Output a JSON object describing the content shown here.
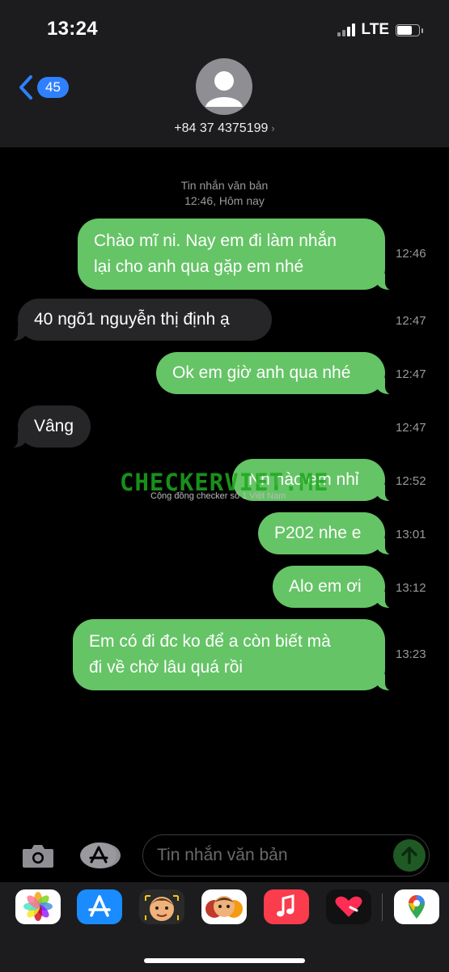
{
  "status": {
    "time": "13:24",
    "network": "LTE"
  },
  "header": {
    "back_count": "45",
    "contact": "+84 37 4375199"
  },
  "conversation": {
    "meta_line1": "Tin nhắn văn bản",
    "meta_line2": "12:46, Hôm nay",
    "messages": [
      {
        "dir": "sent",
        "lines": [
          "Chào mĩ ni. Nay em đi làm nhắn",
          "lại cho anh qua gặp em nhé"
        ],
        "time": "12:46"
      },
      {
        "dir": "received",
        "lines": [
          "40 ngõ1 nguyễn thị định ạ"
        ],
        "time": "12:47"
      },
      {
        "dir": "sent",
        "lines": [
          "Ok em giờ anh qua nhé"
        ],
        "time": "12:47"
      },
      {
        "dir": "received",
        "lines": [
          "Vâng"
        ],
        "time": "12:47"
      },
      {
        "dir": "sent",
        "lines": [
          "Nn nào em nhỉ"
        ],
        "time": "12:52"
      },
      {
        "dir": "sent",
        "lines": [
          "P202 nhe e"
        ],
        "time": "13:01"
      },
      {
        "dir": "sent",
        "lines": [
          "Alo em ơi"
        ],
        "time": "13:12"
      },
      {
        "dir": "sent",
        "lines": [
          "Em có đi đc ko để a còn biết mà",
          "đi về chờ lâu quá rồi"
        ],
        "time": "13:23"
      }
    ]
  },
  "watermark": {
    "title": "CHECKERVIET.ME",
    "subtitle": "Cộng đồng checker số 1 Việt Nam"
  },
  "composer": {
    "placeholder": "Tin nhắn văn bản"
  },
  "apps": [
    {
      "name": "photos-app-icon",
      "color": "#ffffff"
    },
    {
      "name": "appstore-app-icon",
      "color": "#1a8cff"
    },
    {
      "name": "memoji-app-icon",
      "color": "#2a2a2a"
    },
    {
      "name": "animoji-app-icon",
      "color": "#ffffff"
    },
    {
      "name": "music-app-icon",
      "color": "#fa3c4c"
    },
    {
      "name": "digital-touch-app-icon",
      "color": "#111111"
    },
    {
      "name": "maps-app-icon",
      "color": "#ffffff"
    }
  ],
  "colors": {
    "sent_bubble": "#65c466",
    "received_bubble": "#262628",
    "accent": "#2f80ff"
  }
}
